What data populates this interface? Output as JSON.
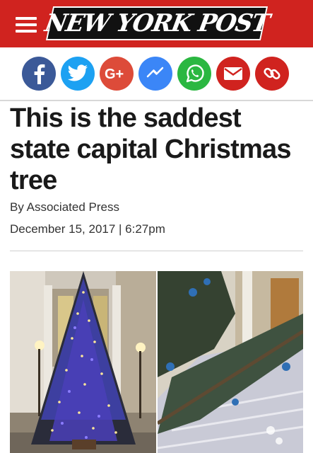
{
  "header": {
    "logo_text": "NEW YORK POST",
    "brand_color": "#d0231f"
  },
  "share_buttons": [
    {
      "name": "facebook",
      "icon": "facebook-icon",
      "color": "#3b5998"
    },
    {
      "name": "twitter",
      "icon": "twitter-icon",
      "color": "#1da1f2"
    },
    {
      "name": "google-plus",
      "icon": "google-plus-icon",
      "color": "#dd4b39"
    },
    {
      "name": "messenger",
      "icon": "messenger-icon",
      "color": "#3b86f7"
    },
    {
      "name": "whatsapp",
      "icon": "whatsapp-icon",
      "color": "#2bb741"
    },
    {
      "name": "email",
      "icon": "email-icon",
      "color": "#d0231f"
    },
    {
      "name": "copy-link",
      "icon": "link-icon",
      "color": "#d0231f"
    }
  ],
  "article": {
    "headline": "This is the saddest state capital Christmas tree",
    "byline": "By Associated Press",
    "date": "December 15, 2017 | 6:27pm"
  },
  "photos": [
    {
      "icon": "christmas-tree-photo"
    },
    {
      "icon": "fallen-tree-photo"
    }
  ]
}
